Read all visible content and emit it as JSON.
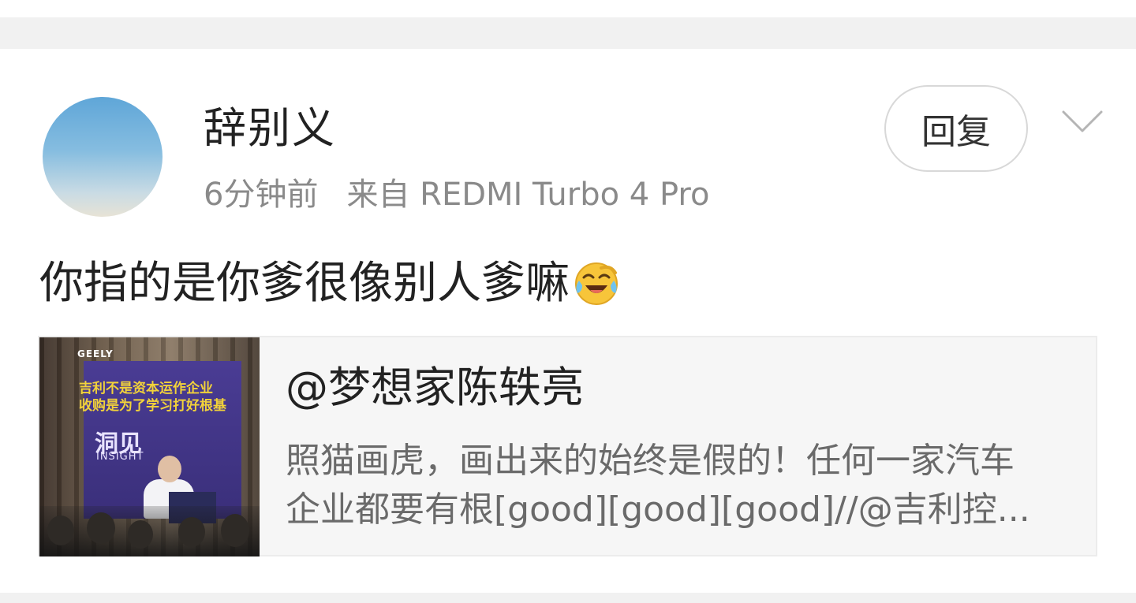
{
  "comment": {
    "author": "辞别义",
    "time": "6分钟前",
    "source": "来自 REDMI Turbo 4 Pro",
    "reply_label": "回复",
    "text": "你指的是你爹很像别人爹嘛",
    "emoji": "laugh-cry-emoji"
  },
  "quoted_post": {
    "author": "@梦想家陈轶亮",
    "text_line1": "照猫画虎，画出来的始终是假的！任何一家汽车",
    "text_line2": "企业都要有根[good][good][good]//@吉利控...",
    "thumbnail": {
      "brand": "GEELY",
      "headline_line1": "吉利不是资本运作企业",
      "headline_line2": "收购是为了学习打好根基",
      "logo_cn": "洞见",
      "logo_en": "INSIGHT"
    }
  },
  "colors": {
    "divider": "#f1f1f1",
    "quote_background": "#f6f6f6",
    "meta_text": "#8a8a8a"
  }
}
